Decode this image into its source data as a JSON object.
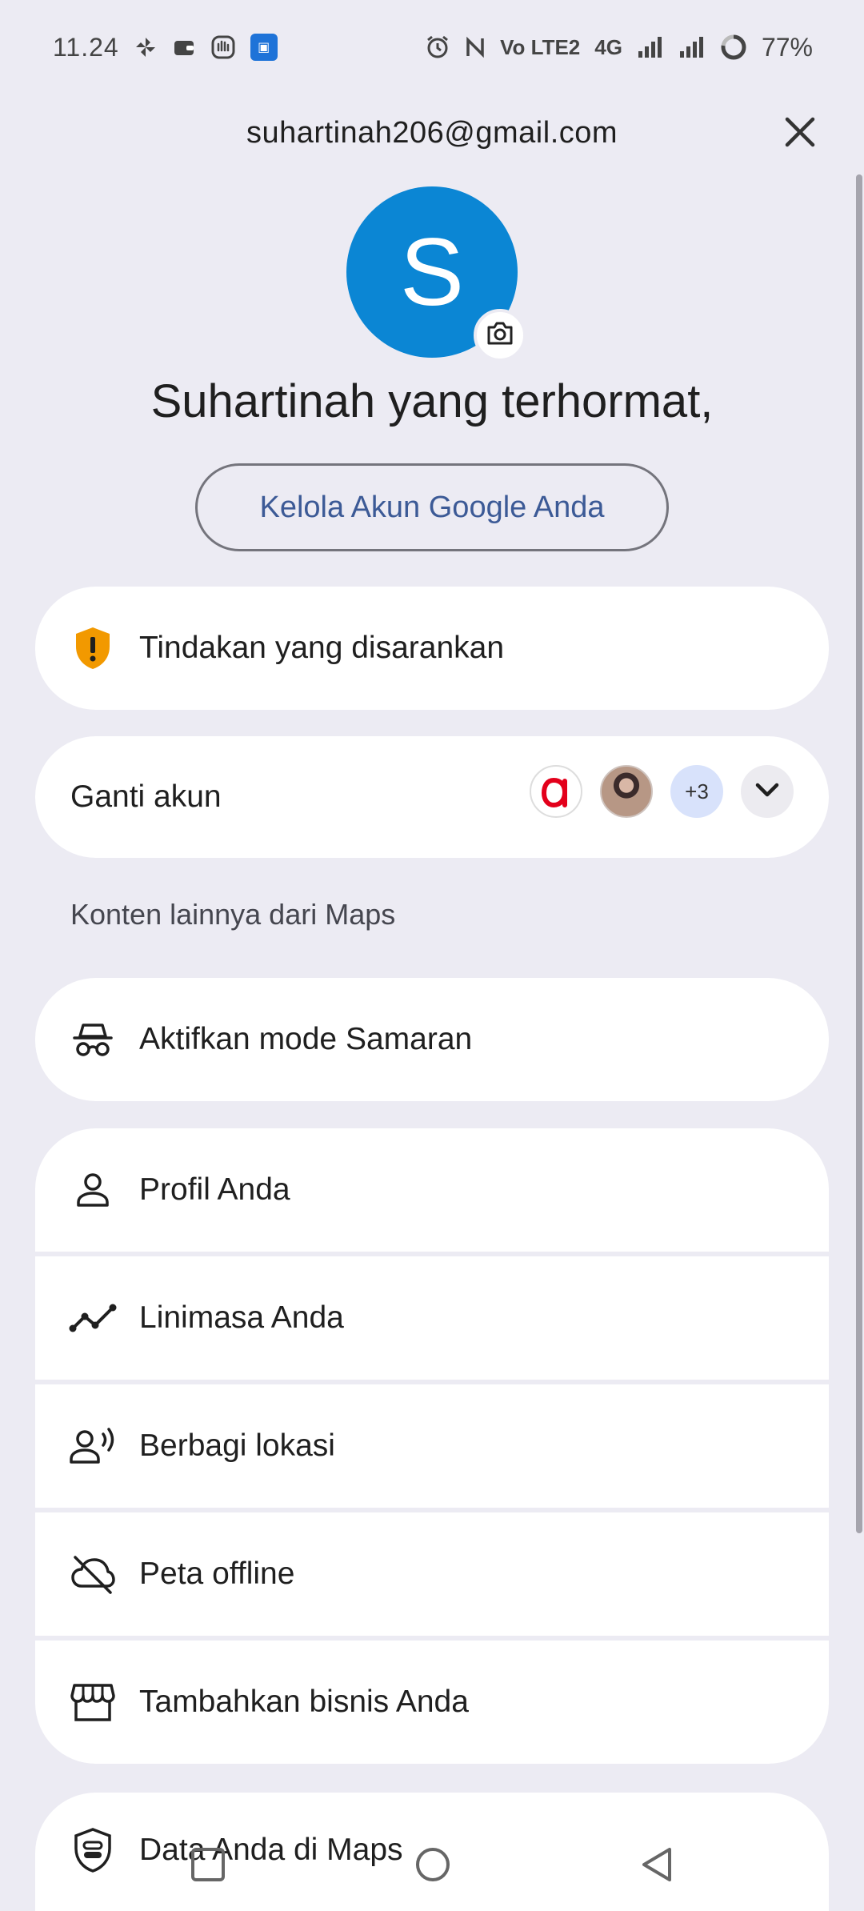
{
  "status_bar": {
    "time": "11.24",
    "network": "4G",
    "volte": "Vo LTE2",
    "battery": "77%",
    "icons": [
      "pinwheel-icon",
      "wallet-icon",
      "hand-icon",
      "app-icon",
      "alarm-icon",
      "nfc-icon",
      "signal-icon",
      "battery-ring-icon"
    ]
  },
  "header": {
    "email": "suhartinah206@gmail.com",
    "close_icon": "close-icon"
  },
  "profile": {
    "avatar_letter": "S",
    "avatar_color": "#0b86d4",
    "greeting": "Suhartinah yang terhormat,",
    "manage_button": "Kelola Akun Google Anda"
  },
  "recommended": {
    "label": "Tindakan yang disarankan",
    "icon": "shield-warning-icon",
    "icon_color": "#f29900"
  },
  "switch_account": {
    "label": "Ganti akun",
    "more_count": "+3"
  },
  "section": {
    "label": "Konten lainnya dari Maps"
  },
  "incognito": {
    "label": "Aktifkan mode Samaran",
    "icon": "incognito-icon"
  },
  "menu_items": [
    {
      "label": "Profil Anda",
      "icon": "person-icon"
    },
    {
      "label": "Linimasa Anda",
      "icon": "timeline-icon"
    },
    {
      "label": "Berbagi lokasi",
      "icon": "location-sharing-icon"
    },
    {
      "label": "Peta offline",
      "icon": "offline-map-icon"
    },
    {
      "label": "Tambahkan bisnis Anda",
      "icon": "storefront-icon"
    }
  ],
  "data_item": {
    "label": "Data Anda di Maps",
    "icon": "data-shield-icon"
  },
  "navbar": {
    "icons": [
      "recents-icon",
      "home-icon",
      "back-icon"
    ]
  }
}
